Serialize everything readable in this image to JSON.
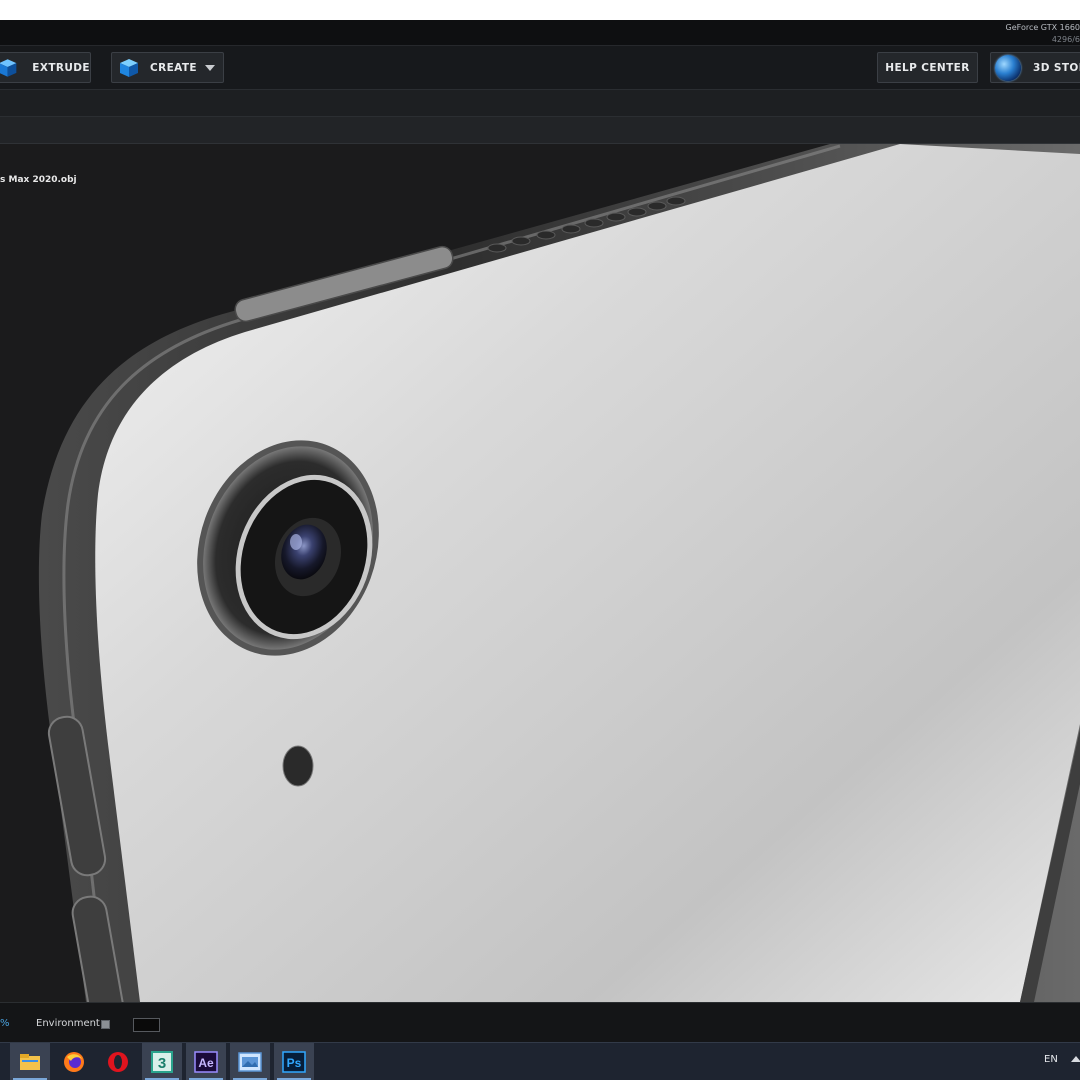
{
  "window": {
    "gpu_name": "GeForce GTX 1660",
    "gpu_memory": "4296/6"
  },
  "toolbar": {
    "extrude_label": "EXTRUDE",
    "create_label": "CREATE",
    "help_label": "HELP CENTER",
    "store_label": "3D STOR"
  },
  "viewport": {
    "file_name": "s Max 2020.obj",
    "background_color": "#1b1b1c"
  },
  "status": {
    "percent_fragment": "%",
    "environment_label": "Environment"
  },
  "taskbar": {
    "items": [
      {
        "icon": "file-explorer-icon",
        "active": true
      },
      {
        "icon": "firefox-icon",
        "active": false
      },
      {
        "icon": "opera-icon",
        "active": false
      },
      {
        "icon": "3ds-max-icon",
        "active": true
      },
      {
        "icon": "after-effects-icon",
        "active": true
      },
      {
        "icon": "photo-viewer-icon",
        "active": true
      },
      {
        "icon": "photoshop-icon",
        "active": true
      }
    ],
    "ae_label": "Ae",
    "ps_label": "Ps",
    "max_label": "3",
    "language": "EN"
  }
}
